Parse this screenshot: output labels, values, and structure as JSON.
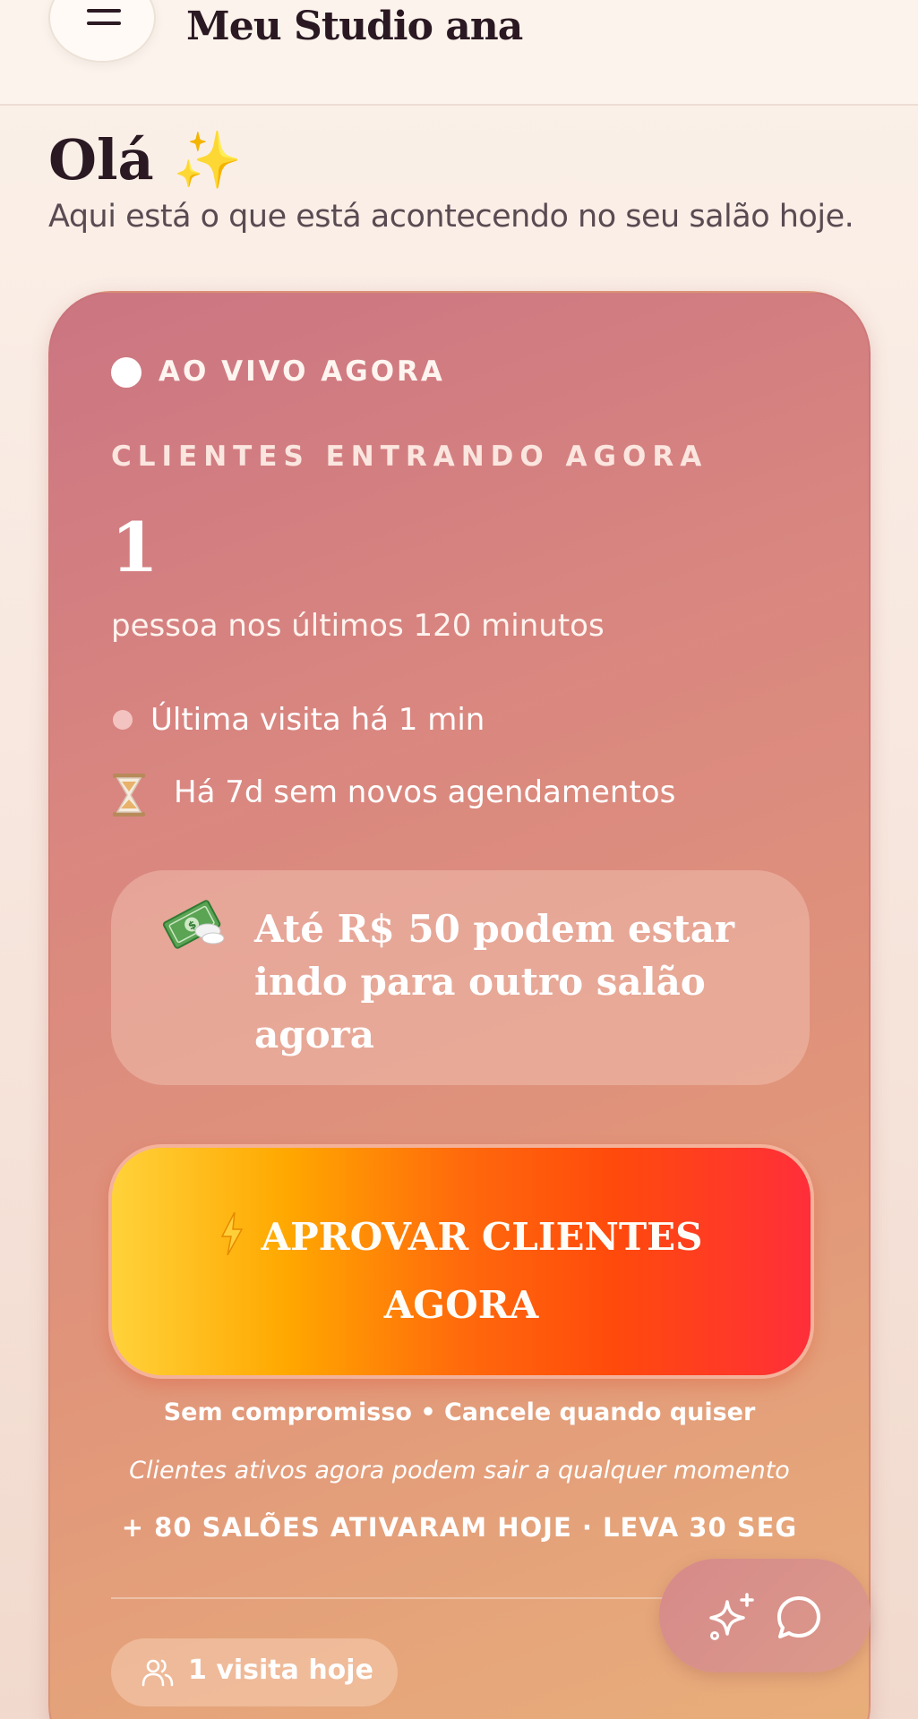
{
  "header": {
    "title": "Meu Studio ana",
    "menu_icon": "hamburger-menu-icon"
  },
  "greeting": {
    "title": "Olá ✨",
    "subtitle": "Aqui está o que está acontecendo no seu salão hoje."
  },
  "live_card": {
    "live_label": "AO VIVO AGORA",
    "section_label": "CLIENTES ENTRANDO AGORA",
    "count": "1",
    "count_description": "pessoa nos últimos 120 minutos",
    "last_visit": "Última visita  há 1 min",
    "no_bookings": "Há  7d  sem novos agendamentos",
    "loss_message": "Até R$ 50 podem estar indo para outro salão agora",
    "cta_line1": "APROVAR CLIENTES",
    "cta_line2": "AGORA",
    "terms": "Sem compromisso • Cancele quando quiser",
    "warning": "Clientes ativos agora podem sair a qualquer momento",
    "social_proof": "+ 80 SALÕES ATIVARAM HOJE · LEVA 30 SEG",
    "visits_today": "1  visita  hoje"
  },
  "fab": {
    "sparkle_icon": "sparkle-icon",
    "chat_icon": "chat-bubble-icon"
  },
  "colors": {
    "card_gradient_start": "#cb7582",
    "card_gradient_end": "#e9b07a",
    "cta_gradient_start": "#ffd23a",
    "cta_gradient_end": "#ff2e3a",
    "title_text": "#2a1822"
  }
}
